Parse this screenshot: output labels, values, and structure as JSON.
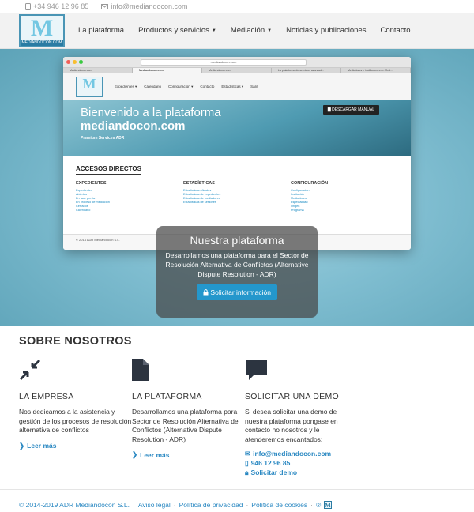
{
  "topbar": {
    "phone": "+34 946 12 96 85",
    "email": "info@mediandocon.com"
  },
  "logo": {
    "letter": "M",
    "text": "MEDIANDOCON.COM"
  },
  "nav": {
    "items": [
      {
        "label": "La plataforma",
        "dropdown": false
      },
      {
        "label": "Productos y servicios",
        "dropdown": true
      },
      {
        "label": "Mediación",
        "dropdown": true
      },
      {
        "label": "Noticias y publicaciones",
        "dropdown": false
      },
      {
        "label": "Contacto",
        "dropdown": false
      }
    ]
  },
  "browser": {
    "url": "mediandocon.com",
    "tabs": [
      "Mediandocon.com",
      "Mediandocon.com",
      "Mediandocon.com",
      "La plataforma de servicios avanzad...",
      "Mediadores e instituciones en Med..."
    ],
    "active_tab": 1,
    "nav": [
      "Expedientes ▾",
      "Calendario",
      "Configuración ▾",
      "Contacto",
      "Estadísticas ▾",
      "Salir"
    ],
    "hero_line1": "Bienvenido a la plataforma",
    "hero_line2": "mediandocon.com",
    "hero_sub": "Premium Services ADR",
    "download_label": "DESCARGAR MANUAL",
    "accesos_title": "ACCESOS DIRECTOS",
    "columns": [
      {
        "title": "EXPEDIENTES",
        "items": [
          "Expedientes",
          "Abiertos",
          "En fase previa",
          "En proceso de mediación",
          "Cerrados",
          "Calendario"
        ]
      },
      {
        "title": "ESTADÍSTICAS",
        "items": [
          "Estadísticas oficiales",
          "Estadísticas de expedientes",
          "Estadísticas de mediadores",
          "Estadísticas de sesiones"
        ]
      },
      {
        "title": "CONFIGURACIÓN",
        "items": [
          "Configuración",
          "Institución",
          "Mediadores",
          "Especialidad",
          "Origen",
          "Programa"
        ]
      }
    ],
    "footer": "© 2014 ADR Mediandocon S.L."
  },
  "overlay": {
    "title": "Nuestra plataforma",
    "description": "Desarrollamos una plataforma para el Sector de Resolución Alternativa de Conflictos (Alternative Dispute Resolution - ADR)",
    "button": "Solicitar información"
  },
  "about": {
    "title": "SOBRE NOSOTROS",
    "columns": [
      {
        "icon": "compress-arrows-icon",
        "title": "LA EMPRESA",
        "text": "Nos dedicamos a la asistencia y gestión de los procesos de resolución alternativa de conflictos",
        "link": "Leer más"
      },
      {
        "icon": "document-icon",
        "title": "LA PLATAFORMA",
        "text": "Desarrollamos una plataforma para Sector de Resolución Alternativa de Conflictos (Alternative Dispute Resolution - ADR)",
        "link": "Leer más"
      },
      {
        "icon": "chat-bubble-icon",
        "title": "SOLICITAR UNA DEMO",
        "text": "Si desea solicitar una demo de nuestra plataforma pongase en contacto no nosotros y le atenderemos encantados:",
        "email": "info@mediandocon.com",
        "phone": "946 12 96 85",
        "demo": "Solicitar demo"
      }
    ]
  },
  "footer": {
    "copyright": "© 2014-2019 ADR Mediandocon S.L.",
    "links": [
      "Aviso legal",
      "Política de privacidad",
      "Política de cookies"
    ],
    "trailing": "®"
  }
}
